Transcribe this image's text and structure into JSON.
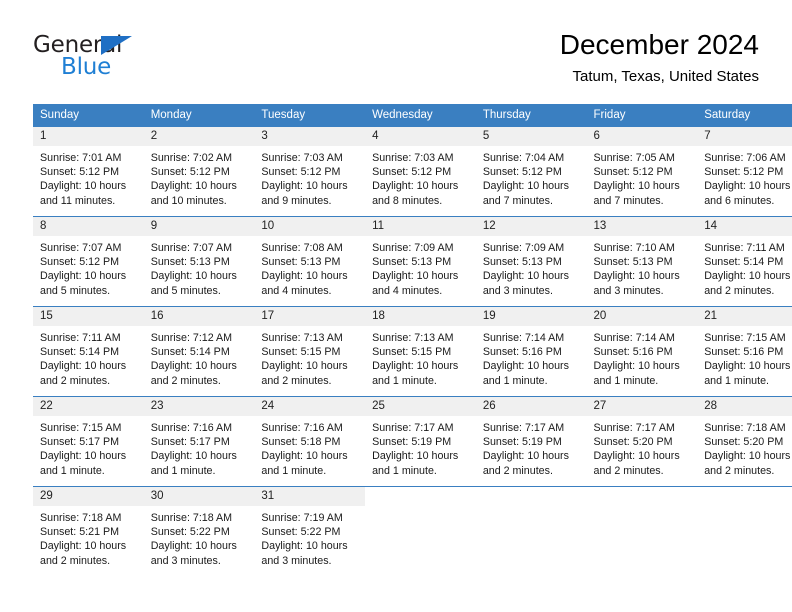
{
  "brand": {
    "word_dark": "General",
    "word_blue": "Blue",
    "flag_icon": "triangle-flag-icon",
    "accent_color": "#1f7fd4"
  },
  "header": {
    "title": "December 2024",
    "subtitle": "Tatum, Texas, United States"
  },
  "theme": {
    "header_blue": "#3a7fc1",
    "daynum_band": "#f0f0f0",
    "text": "#1a1a1a"
  },
  "weekdays": [
    "Sunday",
    "Monday",
    "Tuesday",
    "Wednesday",
    "Thursday",
    "Friday",
    "Saturday"
  ],
  "weeks": [
    [
      {
        "day": "1",
        "sunrise": "Sunrise: 7:01 AM",
        "sunset": "Sunset: 5:12 PM",
        "daylight1": "Daylight: 10 hours",
        "daylight2": "and 11 minutes."
      },
      {
        "day": "2",
        "sunrise": "Sunrise: 7:02 AM",
        "sunset": "Sunset: 5:12 PM",
        "daylight1": "Daylight: 10 hours",
        "daylight2": "and 10 minutes."
      },
      {
        "day": "3",
        "sunrise": "Sunrise: 7:03 AM",
        "sunset": "Sunset: 5:12 PM",
        "daylight1": "Daylight: 10 hours",
        "daylight2": "and 9 minutes."
      },
      {
        "day": "4",
        "sunrise": "Sunrise: 7:03 AM",
        "sunset": "Sunset: 5:12 PM",
        "daylight1": "Daylight: 10 hours",
        "daylight2": "and 8 minutes."
      },
      {
        "day": "5",
        "sunrise": "Sunrise: 7:04 AM",
        "sunset": "Sunset: 5:12 PM",
        "daylight1": "Daylight: 10 hours",
        "daylight2": "and 7 minutes."
      },
      {
        "day": "6",
        "sunrise": "Sunrise: 7:05 AM",
        "sunset": "Sunset: 5:12 PM",
        "daylight1": "Daylight: 10 hours",
        "daylight2": "and 7 minutes."
      },
      {
        "day": "7",
        "sunrise": "Sunrise: 7:06 AM",
        "sunset": "Sunset: 5:12 PM",
        "daylight1": "Daylight: 10 hours",
        "daylight2": "and 6 minutes."
      }
    ],
    [
      {
        "day": "8",
        "sunrise": "Sunrise: 7:07 AM",
        "sunset": "Sunset: 5:12 PM",
        "daylight1": "Daylight: 10 hours",
        "daylight2": "and 5 minutes."
      },
      {
        "day": "9",
        "sunrise": "Sunrise: 7:07 AM",
        "sunset": "Sunset: 5:13 PM",
        "daylight1": "Daylight: 10 hours",
        "daylight2": "and 5 minutes."
      },
      {
        "day": "10",
        "sunrise": "Sunrise: 7:08 AM",
        "sunset": "Sunset: 5:13 PM",
        "daylight1": "Daylight: 10 hours",
        "daylight2": "and 4 minutes."
      },
      {
        "day": "11",
        "sunrise": "Sunrise: 7:09 AM",
        "sunset": "Sunset: 5:13 PM",
        "daylight1": "Daylight: 10 hours",
        "daylight2": "and 4 minutes."
      },
      {
        "day": "12",
        "sunrise": "Sunrise: 7:09 AM",
        "sunset": "Sunset: 5:13 PM",
        "daylight1": "Daylight: 10 hours",
        "daylight2": "and 3 minutes."
      },
      {
        "day": "13",
        "sunrise": "Sunrise: 7:10 AM",
        "sunset": "Sunset: 5:13 PM",
        "daylight1": "Daylight: 10 hours",
        "daylight2": "and 3 minutes."
      },
      {
        "day": "14",
        "sunrise": "Sunrise: 7:11 AM",
        "sunset": "Sunset: 5:14 PM",
        "daylight1": "Daylight: 10 hours",
        "daylight2": "and 2 minutes."
      }
    ],
    [
      {
        "day": "15",
        "sunrise": "Sunrise: 7:11 AM",
        "sunset": "Sunset: 5:14 PM",
        "daylight1": "Daylight: 10 hours",
        "daylight2": "and 2 minutes."
      },
      {
        "day": "16",
        "sunrise": "Sunrise: 7:12 AM",
        "sunset": "Sunset: 5:14 PM",
        "daylight1": "Daylight: 10 hours",
        "daylight2": "and 2 minutes."
      },
      {
        "day": "17",
        "sunrise": "Sunrise: 7:13 AM",
        "sunset": "Sunset: 5:15 PM",
        "daylight1": "Daylight: 10 hours",
        "daylight2": "and 2 minutes."
      },
      {
        "day": "18",
        "sunrise": "Sunrise: 7:13 AM",
        "sunset": "Sunset: 5:15 PM",
        "daylight1": "Daylight: 10 hours",
        "daylight2": "and 1 minute."
      },
      {
        "day": "19",
        "sunrise": "Sunrise: 7:14 AM",
        "sunset": "Sunset: 5:16 PM",
        "daylight1": "Daylight: 10 hours",
        "daylight2": "and 1 minute."
      },
      {
        "day": "20",
        "sunrise": "Sunrise: 7:14 AM",
        "sunset": "Sunset: 5:16 PM",
        "daylight1": "Daylight: 10 hours",
        "daylight2": "and 1 minute."
      },
      {
        "day": "21",
        "sunrise": "Sunrise: 7:15 AM",
        "sunset": "Sunset: 5:16 PM",
        "daylight1": "Daylight: 10 hours",
        "daylight2": "and 1 minute."
      }
    ],
    [
      {
        "day": "22",
        "sunrise": "Sunrise: 7:15 AM",
        "sunset": "Sunset: 5:17 PM",
        "daylight1": "Daylight: 10 hours",
        "daylight2": "and 1 minute."
      },
      {
        "day": "23",
        "sunrise": "Sunrise: 7:16 AM",
        "sunset": "Sunset: 5:17 PM",
        "daylight1": "Daylight: 10 hours",
        "daylight2": "and 1 minute."
      },
      {
        "day": "24",
        "sunrise": "Sunrise: 7:16 AM",
        "sunset": "Sunset: 5:18 PM",
        "daylight1": "Daylight: 10 hours",
        "daylight2": "and 1 minute."
      },
      {
        "day": "25",
        "sunrise": "Sunrise: 7:17 AM",
        "sunset": "Sunset: 5:19 PM",
        "daylight1": "Daylight: 10 hours",
        "daylight2": "and 1 minute."
      },
      {
        "day": "26",
        "sunrise": "Sunrise: 7:17 AM",
        "sunset": "Sunset: 5:19 PM",
        "daylight1": "Daylight: 10 hours",
        "daylight2": "and 2 minutes."
      },
      {
        "day": "27",
        "sunrise": "Sunrise: 7:17 AM",
        "sunset": "Sunset: 5:20 PM",
        "daylight1": "Daylight: 10 hours",
        "daylight2": "and 2 minutes."
      },
      {
        "day": "28",
        "sunrise": "Sunrise: 7:18 AM",
        "sunset": "Sunset: 5:20 PM",
        "daylight1": "Daylight: 10 hours",
        "daylight2": "and 2 minutes."
      }
    ],
    [
      {
        "day": "29",
        "sunrise": "Sunrise: 7:18 AM",
        "sunset": "Sunset: 5:21 PM",
        "daylight1": "Daylight: 10 hours",
        "daylight2": "and 2 minutes."
      },
      {
        "day": "30",
        "sunrise": "Sunrise: 7:18 AM",
        "sunset": "Sunset: 5:22 PM",
        "daylight1": "Daylight: 10 hours",
        "daylight2": "and 3 minutes."
      },
      {
        "day": "31",
        "sunrise": "Sunrise: 7:19 AM",
        "sunset": "Sunset: 5:22 PM",
        "daylight1": "Daylight: 10 hours",
        "daylight2": "and 3 minutes."
      },
      {
        "day": "",
        "sunrise": "",
        "sunset": "",
        "daylight1": "",
        "daylight2": ""
      },
      {
        "day": "",
        "sunrise": "",
        "sunset": "",
        "daylight1": "",
        "daylight2": ""
      },
      {
        "day": "",
        "sunrise": "",
        "sunset": "",
        "daylight1": "",
        "daylight2": ""
      },
      {
        "day": "",
        "sunrise": "",
        "sunset": "",
        "daylight1": "",
        "daylight2": ""
      }
    ]
  ]
}
